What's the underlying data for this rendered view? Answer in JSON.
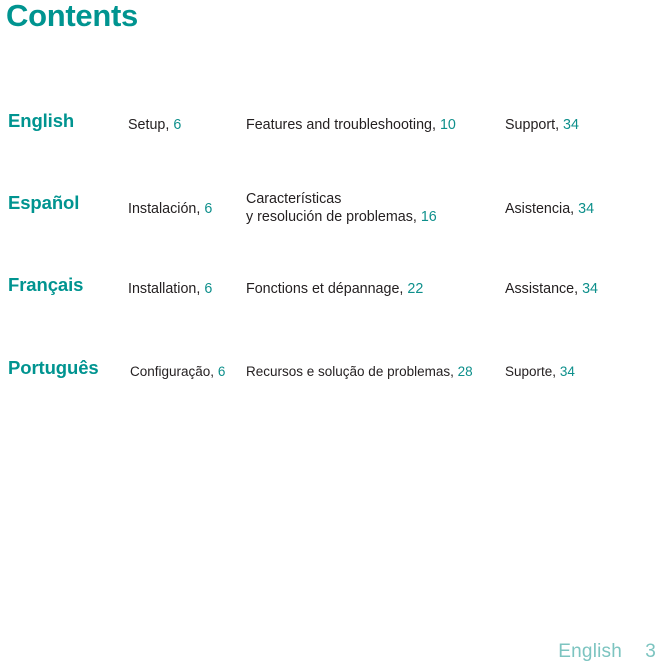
{
  "page": {
    "title": "Contents",
    "colors": {
      "accent_teal": "#009490",
      "page_number_teal": "#0d8f8b",
      "body_text": "#231f20",
      "footer_teal": "#7cc4c0",
      "background": "#ffffff"
    }
  },
  "contents": {
    "rows": [
      {
        "language": "English",
        "setup": {
          "label": "Setup,",
          "page": "6"
        },
        "features": {
          "line1": "Features and troubleshooting,",
          "line2": "",
          "page": "10"
        },
        "support": {
          "label": "Support,",
          "page": "34"
        }
      },
      {
        "language": "Español",
        "setup": {
          "label": "Instalación,",
          "page": "6"
        },
        "features": {
          "line1": "Características",
          "line2": "y resolución de problemas,",
          "page": "16"
        },
        "support": {
          "label": "Asistencia,",
          "page": "34"
        }
      },
      {
        "language": "Français",
        "setup": {
          "label": "Installation,",
          "page": "6"
        },
        "features": {
          "line1": "Fonctions et dépannage,",
          "line2": "",
          "page": "22"
        },
        "support": {
          "label": "Assistance,",
          "page": "34"
        }
      },
      {
        "language": "Português",
        "setup": {
          "label": "Configuração,",
          "page": "6"
        },
        "features": {
          "line1": "Recursos e solução de problemas,",
          "line2": "",
          "page": "28"
        },
        "support": {
          "label": "Suporte,",
          "page": "34"
        }
      }
    ]
  },
  "footer": {
    "language": "English",
    "folio": "3"
  }
}
